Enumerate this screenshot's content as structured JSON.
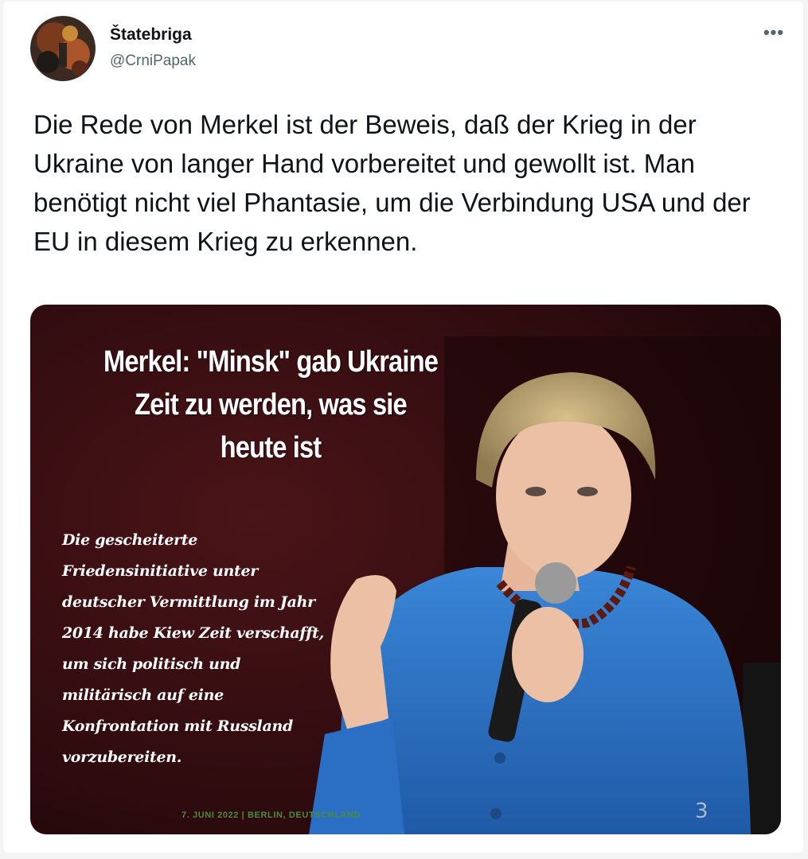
{
  "tweet": {
    "display_name": "Štatebriga",
    "handle": "@CrniPapak",
    "more_icon": "more-horizontal-icon",
    "text": "Die Rede von Merkel ist der Beweis, daß der Krieg in der Ukraine von langer Hand vorbereitet und gewollt ist. Man benötigt nicht viel Phantasie, um die Verbindung USA und der EU in diesem Krieg zu erkennen."
  },
  "media": {
    "headline": "Merkel: \"Minsk\" gab Ukraine Zeit zu werden, was sie heute ist",
    "quote": "Die gescheiterte Friedensinitiative unter deutscher Vermittlung im Jahr 2014 habe Kiew Zeit verschafft, um sich politisch und militärisch auf eine Konfrontation mit Russland vorzubereiten.",
    "dateline": "7. JUNI 2022 | BERLIN, DEUTSCHLAND",
    "colors": {
      "background": "#3a0f12",
      "jacket": "#2a6fc4",
      "dateline": "#4f8a3c"
    }
  }
}
